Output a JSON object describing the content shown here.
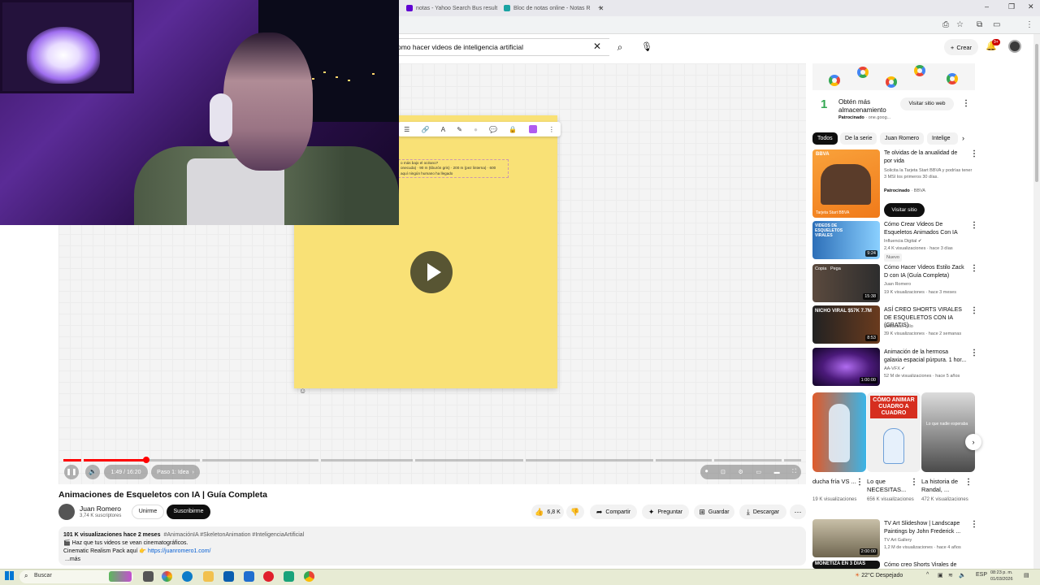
{
  "browser": {
    "tabs": [
      {
        "title": "notas - Yahoo Search Bus result",
        "color": "#6001d2"
      },
      {
        "title": "Bloc de notas online - Notas R",
        "color": "#1aa3a3"
      }
    ],
    "new_tab": "+",
    "window_controls": {
      "minimize": "–",
      "restore": "❐",
      "close": "✕"
    }
  },
  "header": {
    "search_value": "omo hacer videos de inteligencia artificial",
    "create_label": "Crear",
    "notif_count": "9+"
  },
  "player": {
    "time": "1:49 / 16:20",
    "chapter": "Paso 1: Idea",
    "progress": 0.112,
    "sticky_text": "o más bajo el océano?\nonecuda) · 90 m (tiburón gris) · 200 m (pez linterna) · 600\n aquí ningún humano ha llegado"
  },
  "video": {
    "title": "Animaciones de Esqueletos con IA | Guía Completa",
    "channel": "Juan Romero",
    "subscribers": "3,74 K suscriptores",
    "join_label": "Unirme",
    "subscribe_label": "Suscribirme",
    "likes": "6,8 K",
    "share_label": "Compartir",
    "ask_label": "Preguntar",
    "save_label": "Guardar",
    "download_label": "Descargar",
    "desc_stats": "101 K visualizaciones  hace 2 meses",
    "desc_tags": "#AnimaciónIA #SkeletonAnimation #InteligenciaArtificial",
    "desc_line1": "🎬 Haz que tus videos se vean cinematográficos.",
    "desc_line2_prefix": "Cinematic Realism Pack aquí 👉",
    "desc_link": "https://juanromero1.com/",
    "desc_more": "...más"
  },
  "sidebar": {
    "ad": {
      "num": "1",
      "title": "Obtén más almacenamiento",
      "sponsored": "Patrocinado",
      "domain": "· one.goog...",
      "visit": "Visitar sitio web"
    },
    "chips": [
      "Todos",
      "De la serie",
      "Juan Romero",
      "Intelige"
    ],
    "ad2": {
      "title": "Te olvidas de la anualidad de por vida",
      "desc": "Solicita la Tarjeta Start BBVA y podrías tener 3 MSI los primeros 30 días.",
      "sponsored": "Patrocinado",
      "brand": "· BBVA",
      "visit": "Visitar sitio",
      "thumb_label": "BBVA",
      "thumb_caption": "Tarjeta Start BBVA"
    },
    "recs": [
      {
        "title": "Cómo Crear Videos De Esqueletos Animados Con IA",
        "channel": "Influencia Digital ✔",
        "views": "2,4 K visualizaciones · hace 3 días",
        "badge": "Nuevo",
        "duration": "9:24",
        "thumb_text": "VIDEOS DE ESQUELETOS VIRALES"
      },
      {
        "title": "Cómo Hacer Videos Estilo Zack D con IA (Guía Completa)",
        "channel": "Juan Romero",
        "views": "19 K visualizaciones · hace 3 meses",
        "duration": "15:38",
        "thumb_text": "Copia   Pega"
      },
      {
        "title": "ASÍ CREO SHORTS VIRALES DE ESQUELETOS CON IA (GRATIS)",
        "channel": "Sebastian Lillo",
        "views": "39 K visualizaciones · hace 2 semanas",
        "duration": "8:53",
        "thumb_text": "NICHO VIRAL  $57K  7.7M"
      },
      {
        "title": "Animación de la hermosa galaxia espacial púrpura. 1 hor...",
        "channel": "AA-VFX ✔",
        "views": "52 M de visualizaciones · hace 5 años",
        "duration": "1:00:00"
      }
    ],
    "shorts": [
      {
        "title": "ducha fría VS ...",
        "views": "19 K visualizaciones"
      },
      {
        "title": "Lo que NECESITAS...",
        "views": "656 K visualizaciones",
        "thumb_text": "CÓMO ANIMAR CUADRO A CUADRO"
      },
      {
        "title": "La historia de Randal, ...",
        "views": "472 K visualizaciones",
        "thumb_text": "Lo que nadie esperaba"
      }
    ],
    "rec_bottom": [
      {
        "title": "TV Art Slideshow | Landscape Paintings by John Frederick ...",
        "channel": "TV Art Gallery",
        "views": "1,2 M de visualizaciones · hace 4 años",
        "duration": "2:00:00"
      },
      {
        "title": "Cómo creo Shorts Virales de",
        "thumb_text": "MONETIZA EN 3 DÍAS"
      }
    ]
  },
  "taskbar": {
    "search": "Buscar",
    "weather": "22°C  Despejado",
    "lang": "ESP",
    "time": "08:23 p. m.",
    "date": "01/03/2026"
  },
  "colors": {
    "accent": "#ff0000",
    "link": "#065fd4",
    "sticky": "#f9e176"
  }
}
